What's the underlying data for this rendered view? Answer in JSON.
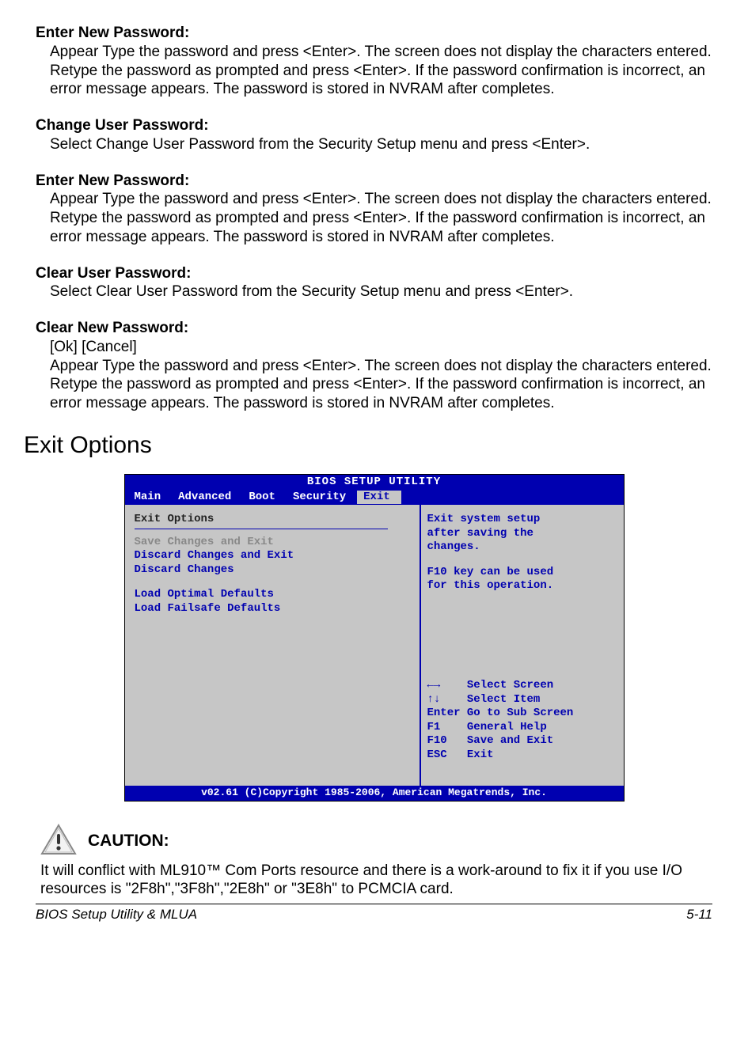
{
  "sections": {
    "s1": {
      "heading": "Enter New Password:",
      "body": "Appear Type the password and press <Enter>. The screen does not display the characters entered. Retype the password as prompted and press <Enter>. If the password confirmation is incorrect, an error message appears.  The password is stored in NVRAM after completes."
    },
    "s2": {
      "heading": "Change User Password:",
      "body": "Select Change User Password from the Security Setup menu and press <Enter>."
    },
    "s3": {
      "heading": "Enter New Password:",
      "body": "Appear Type the password and press <Enter>. The screen does not display the characters entered. Retype the password as prompted and press <Enter>. If the password confirmation is incorrect, an error message appears.  The password is stored in NVRAM after completes."
    },
    "s4": {
      "heading": "Clear User Password:",
      "body": "Select Clear User Password from the Security Setup menu and press <Enter>."
    },
    "s5": {
      "heading": "Clear New Password:",
      "body_line1": "[Ok] [Cancel]",
      "body_line2": "Appear Type the password and press <Enter>. The screen does not display the characters entered. Retype the password as prompted and press <Enter>. If the password confirmation is incorrect, an error message appears.  The password is stored in NVRAM after completes."
    }
  },
  "page_heading": "Exit Options",
  "bios": {
    "title": "BIOS SETUP UTILITY",
    "tabs": [
      "Main",
      "Advanced",
      "Boot",
      "Security",
      "Exit"
    ],
    "active_tab": "Exit",
    "panel_title": "Exit Options",
    "items": {
      "i0": "Save Changes and Exit",
      "i1": "Discard Changes and Exit",
      "i2": "Discard Changes",
      "i3": "Load Optimal Defaults",
      "i4": "Load Failsafe Defaults"
    },
    "help": {
      "l1": "Exit system setup",
      "l2": "after saving the",
      "l3": "changes.",
      "l4": "F10 key can be used",
      "l5": "for this operation."
    },
    "keys": {
      "k1": "←→    Select Screen",
      "k2": "↑↓    Select Item",
      "k3": "Enter Go to Sub Screen",
      "k4": "F1    General Help",
      "k5": "F10   Save and Exit",
      "k6": "ESC   Exit"
    },
    "footer": "v02.61 (C)Copyright 1985-2006, American Megatrends, Inc."
  },
  "caution": {
    "label": "CAUTION:",
    "body": "It will conflict with ML910™ Com Ports resource and there is a work-around to fix it if you use I/O resources is \"2F8h\",\"3F8h\",\"2E8h\" or \"3E8h\" to PCMCIA card."
  },
  "footer": {
    "left": "BIOS Setup Utility & MLUA",
    "right": "5-11"
  }
}
